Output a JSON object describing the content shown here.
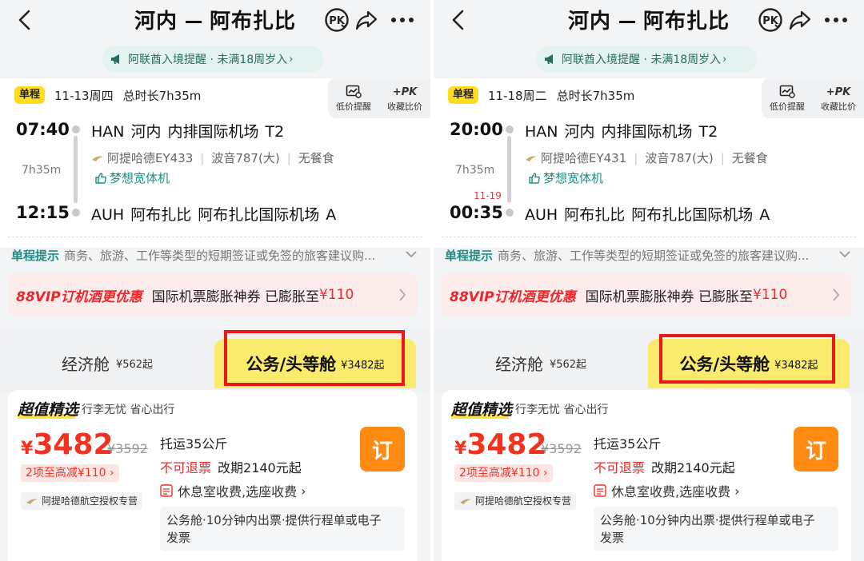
{
  "panels": [
    {
      "header": {
        "origin": "河内",
        "destination": "阿布扎比"
      },
      "notice": {
        "text": "阿联酋入境提醒 · 未满18周岁入"
      },
      "trip": {
        "tag": "单程",
        "date": "11-13周四",
        "duration_total": "总时长7h35m",
        "tools": [
          {
            "label": "低价提醒"
          },
          {
            "label": "收藏比价",
            "icon_text": "+PK"
          }
        ],
        "depart": {
          "time": "07:40",
          "code": "HAN",
          "city": "河内",
          "airport": "内排国际机场",
          "terminal": "T2"
        },
        "arrive": {
          "time": "12:15",
          "code": "AUH",
          "city": "阿布扎比",
          "airport": "阿布扎比国际机场",
          "terminal": "A",
          "next_day": ""
        },
        "duration": "7h35m",
        "flight": "阿提哈德EY433",
        "aircraft": "波音787(大)",
        "meal": "无餐食",
        "widebody": "梦想宽体机"
      },
      "tip": {
        "label": "单程提示",
        "text": "商务、旅游、工作等类型的短期签证或免签的旅客建议购..."
      },
      "vip": {
        "label": "88VIP订机酒更优惠",
        "text": "国际机票膨胀神券 已膨胀至",
        "amount": "¥110"
      },
      "cabins": {
        "economy": {
          "name": "经济舱",
          "price": "¥562起"
        },
        "business": {
          "name": "公务/头等舱",
          "price": "¥3482起"
        }
      },
      "offer": {
        "title": "超值精选",
        "subtitle": "行李无忧 省心出行",
        "currency": "¥",
        "price": "3482",
        "old_price": "¥3592",
        "discount": "2项至高减¥110",
        "agent": "阿提哈德航空授权专营",
        "baggage": "托运35公斤",
        "no_refund": "不可退票",
        "change": "改期2140元起",
        "lounge": "休息室收费,选座收费",
        "service_line1": "公务舱·10分钟内出票·提供行程单或电子",
        "service_line2": "发票",
        "book": "订"
      }
    },
    {
      "header": {
        "origin": "河内",
        "destination": "阿布扎比"
      },
      "notice": {
        "text": "阿联酋入境提醒 · 未满18周岁入"
      },
      "trip": {
        "tag": "单程",
        "date": "11-18周二",
        "duration_total": "总时长7h35m",
        "tools": [
          {
            "label": "低价提醒"
          },
          {
            "label": "收藏比价",
            "icon_text": "+PK"
          }
        ],
        "depart": {
          "time": "20:00",
          "code": "HAN",
          "city": "河内",
          "airport": "内排国际机场",
          "terminal": "T2"
        },
        "arrive": {
          "time": "00:35",
          "code": "AUH",
          "city": "阿布扎比",
          "airport": "阿布扎比国际机场",
          "terminal": "A",
          "next_day": "11-19"
        },
        "duration": "7h35m",
        "flight": "阿提哈德EY431",
        "aircraft": "波音787(大)",
        "meal": "无餐食",
        "widebody": "梦想宽体机"
      },
      "tip": {
        "label": "单程提示",
        "text": "商务、旅游、工作等类型的短期签证或免签的旅客建议购..."
      },
      "vip": {
        "label": "88VIP订机酒更优惠",
        "text": "国际机票膨胀神券 已膨胀至",
        "amount": "¥110"
      },
      "cabins": {
        "economy": {
          "name": "经济舱",
          "price": "¥562起"
        },
        "business": {
          "name": "公务/头等舱",
          "price": "¥3482起"
        }
      },
      "offer": {
        "title": "超值精选",
        "subtitle": "行李无忧 省心出行",
        "currency": "¥",
        "price": "3482",
        "old_price": "¥3592",
        "discount": "2项至高减¥110",
        "agent": "阿提哈德航空授权专营",
        "baggage": "托运35公斤",
        "no_refund": "不可退票",
        "change": "改期2140元起",
        "lounge": "休息室收费,选座收费",
        "service_line1": "公务舱·10分钟内出票·提供行程单或电子",
        "service_line2": "发票",
        "book": "订"
      }
    }
  ],
  "colors": {
    "accent_yellow": "#ffdc1e",
    "teal": "#1a8f86",
    "price_red": "#f2321f",
    "book_orange": "#ff8b12",
    "highlight_box": "#e8181b"
  },
  "icons": [
    "back-icon",
    "pk-compare-icon",
    "share-icon",
    "more-icon",
    "megaphone-icon",
    "price-alert-icon",
    "thumbs-up-icon",
    "airline-logo-icon",
    "chevron-down-icon",
    "chevron-right-icon",
    "lounge-icon"
  ]
}
